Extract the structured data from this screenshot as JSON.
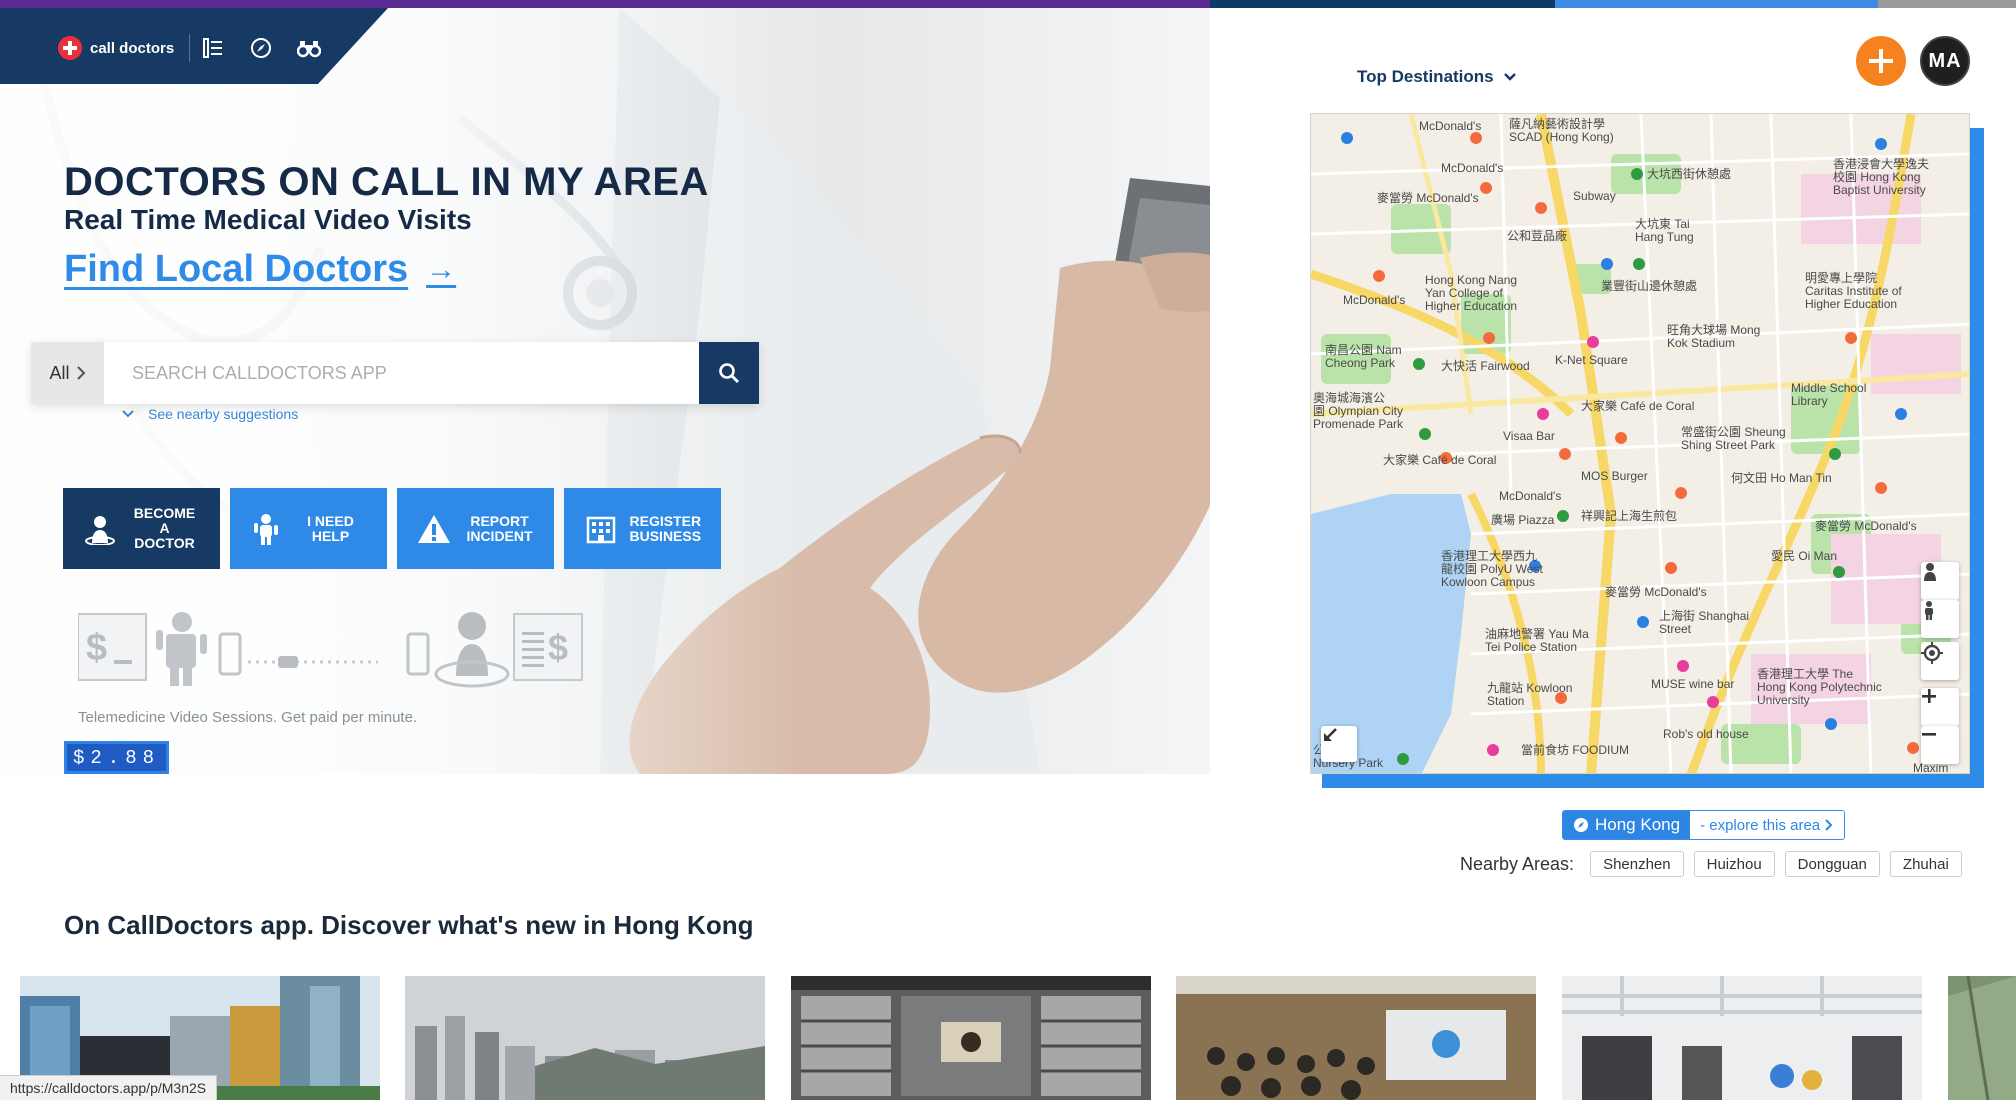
{
  "nav": {
    "brand": "call doctors",
    "icons": [
      "list-icon",
      "compass-icon",
      "binoculars-icon"
    ]
  },
  "hero": {
    "headline": "DOCTORS ON CALL IN MY AREA",
    "subhead": "Real Time Medical Video Visits",
    "find_link": "Find Local Doctors",
    "find_arrow": "→"
  },
  "search": {
    "category": "All",
    "placeholder": "SEARCH CALLDOCTORS APP",
    "nearby_suggestions": "See nearby suggestions"
  },
  "actions": [
    {
      "label": "BECOME A DOCTOR",
      "icon": "doctor-icon"
    },
    {
      "label": "I NEED HELP",
      "icon": "person-icon"
    },
    {
      "label": "REPORT INCIDENT",
      "icon": "warning-icon"
    },
    {
      "label": "REGISTER BUSINESS",
      "icon": "building-icon"
    }
  ],
  "tele": {
    "note": "Telemedicine Video Sessions. Get paid per minute.",
    "price": "$2.88"
  },
  "top_destinations": "Top Destinations",
  "avatar_initials": "MA",
  "map": {
    "labels": [
      "McDonald's",
      "薩凡納藝術設計學\nSCAD (Hong Kong)",
      "McDonald's",
      "大坑西街休憩處",
      "麥當勞 McDonald's",
      "Subway",
      "公和荳品廠",
      "大坑東 Tai\nHang Tung",
      "Hong Kong Nang\nYan College of\nHigher Education",
      "McDonald's",
      "業豐街山邊休憩處",
      "香港浸會大學逸夫\n校園 Hong Kong\nBaptist University",
      "明愛專上學院\nCaritas Institute of\nHigher Education",
      "旺角大球場 Mong\nKok Stadium",
      "南昌公園 Nam\nCheong Park",
      "大快活 Fairwood",
      "K-Net Square",
      "大家樂 Café de Coral",
      "奧海城海濱公\n園 Olympian City\nPromenade Park",
      "Visaa Bar",
      "常盛街公園 Sheung\nShing Street Park",
      "大家樂 Café de Coral",
      "MOS Burger",
      "何文田 Ho Man Tin",
      "McDonald's",
      "廣場 Piazza",
      "祥興記上海生煎包",
      "Middle School\nLibrary",
      "麥當勞 McDonald's",
      "香港理工大學西九\n龍校園 PolyU West\nKowloon Campus",
      "愛民 Oi Man",
      "麥當勞 McDonald's",
      "上海街 Shanghai\nStreet",
      "油麻地警署 Yau Ma\nTei Police Station",
      "MUSE wine bar",
      "香港理工大學 The\nHong Kong Polytechnic\nUniversity",
      "九龍站 Kowloon\nStation",
      "Rob's old house",
      "當前食坊 FOODIUM",
      "公園\nNursery Park",
      "Maxim"
    ]
  },
  "area": {
    "current": "Hong Kong",
    "explore": "- explore this area",
    "nearby_title": "Nearby Areas:",
    "nearby": [
      "Shenzhen",
      "Huizhou",
      "Dongguan",
      "Zhuhai"
    ]
  },
  "discover": {
    "title": "On CallDoctors app. Discover what's new in Hong Kong"
  },
  "status_url": "https://calldoctors.app/p/M3n2S",
  "colors": {
    "navy": "#163a63",
    "blue": "#2e8ae6",
    "orange": "#f5821f",
    "purple": "#5b2a93"
  }
}
